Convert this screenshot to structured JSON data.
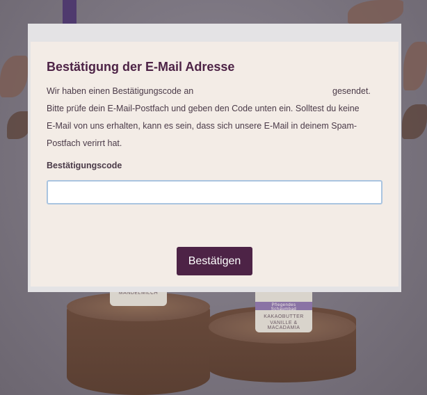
{
  "modal": {
    "title": "Bestätigung der E-Mail Adresse",
    "description": {
      "line1_start": "Wir haben einen Bestätigungscode an",
      "line1_end": "gesendet.",
      "line2": "Bitte prüfe dein E-Mail-Postfach und geben den Code unten ein. Solltest du keine",
      "line3": "E-Mail von uns erhalten, kann es sein, dass sich unsere E-Mail in deinem Spam-",
      "line4": "Postfach verirrt hat."
    },
    "code_label": "Bestätigungscode",
    "code_value": "",
    "confirm_label": "Bestätigen"
  },
  "background": {
    "bottle_left_label": "MANDELMILCH",
    "bottle_right_band": "Pflegendes Schaumbad",
    "bottle_right_label1": "KAKAOBUTTER",
    "bottle_right_label2": "VANILLE & MACADAMIA"
  },
  "colors": {
    "accent": "#4d2346",
    "modal_bg": "#f3ece6",
    "input_border": "#a9c4e0"
  }
}
